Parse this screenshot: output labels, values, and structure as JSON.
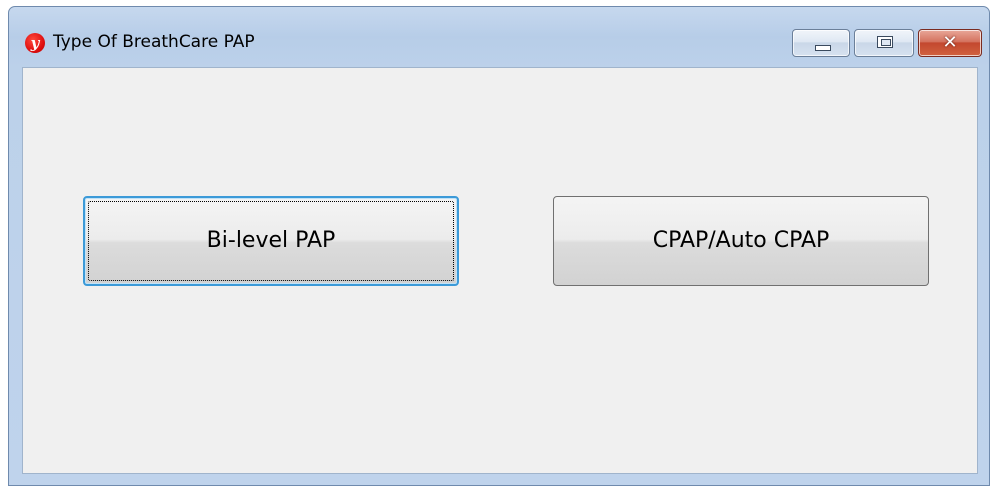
{
  "window": {
    "title": "Type Of BreathCare PAP",
    "app_icon_glyph": "y",
    "app_icon_color": "#e01010"
  },
  "caption_buttons": {
    "minimize_icon": "minimize-icon",
    "maximize_icon": "maximize-icon",
    "close_label": "✕"
  },
  "buttons": {
    "bilevel_label": "Bi-level PAP",
    "cpap_label": "CPAP/Auto CPAP"
  },
  "colors": {
    "focus_border": "#3c9ad8",
    "client_background": "#f0f0f0"
  }
}
